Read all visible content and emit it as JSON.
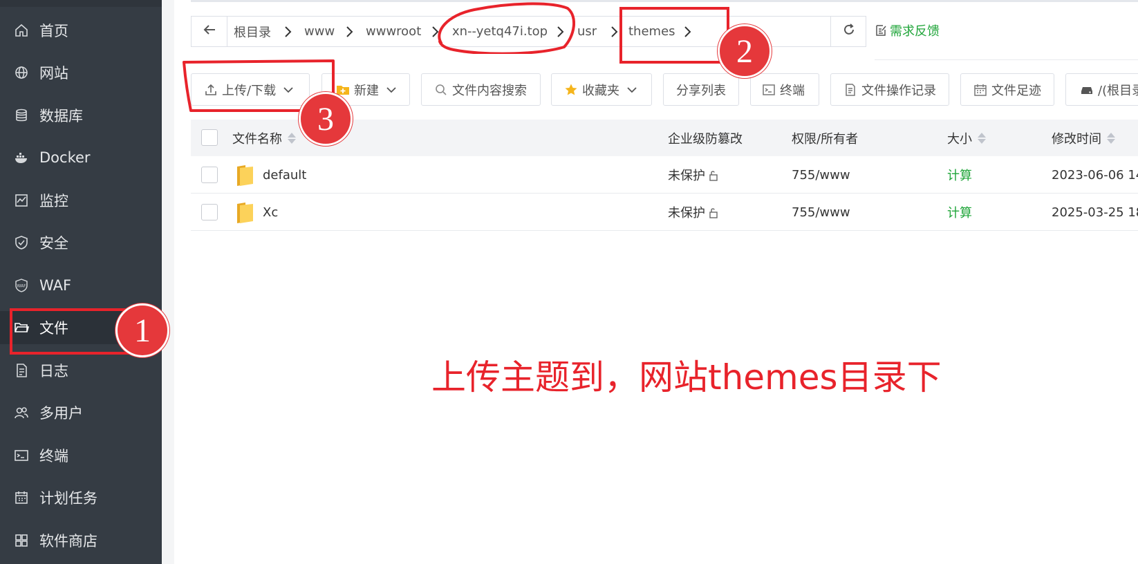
{
  "sidebar": {
    "items": [
      {
        "label": "首页",
        "icon": "home-icon"
      },
      {
        "label": "网站",
        "icon": "globe-icon"
      },
      {
        "label": "数据库",
        "icon": "database-icon"
      },
      {
        "label": "Docker",
        "icon": "docker-icon"
      },
      {
        "label": "监控",
        "icon": "monitor-icon"
      },
      {
        "label": "安全",
        "icon": "shield-icon"
      },
      {
        "label": "WAF",
        "icon": "waf-icon"
      },
      {
        "label": "文件",
        "icon": "folder-icon"
      },
      {
        "label": "日志",
        "icon": "log-icon"
      },
      {
        "label": "多用户",
        "icon": "users-icon"
      },
      {
        "label": "终端",
        "icon": "terminal-icon"
      },
      {
        "label": "计划任务",
        "icon": "calendar-icon"
      },
      {
        "label": "软件商店",
        "icon": "apps-icon"
      }
    ],
    "active_label": "文件"
  },
  "breadcrumb": {
    "items": [
      "根目录",
      "www",
      "wwwroot",
      "xn--yetq47i.top",
      "usr",
      "themes"
    ]
  },
  "feedback_label": "需求反馈",
  "toolbar": {
    "upload_label": "上传/下载",
    "new_label": "新建",
    "search_label": "文件内容搜索",
    "favorites_label": "收藏夹",
    "share_label": "分享列表",
    "terminal_label": "终端",
    "oplog_label": "文件操作记录",
    "footprint_label": "文件足迹",
    "disk_label": "/(根目录"
  },
  "table": {
    "columns": [
      "文件名称",
      "企业级防篡改",
      "权限/所有者",
      "大小",
      "修改时间"
    ],
    "rows": [
      {
        "name": "default",
        "protect": "未保护",
        "perm": "755/www",
        "size": "计算",
        "mtime": "2023-06-06 14"
      },
      {
        "name": "Xc",
        "protect": "未保护",
        "perm": "755/www",
        "size": "计算",
        "mtime": "2025-03-25 18"
      }
    ]
  },
  "annotations": {
    "badge1": "1",
    "badge2": "2",
    "badge3": "3",
    "caption": "上传主题到，网站themes目录下"
  },
  "colors": {
    "sidebar_bg": "#353c44",
    "accent_green": "#20a53a",
    "annotation_red": "#e8232b"
  }
}
